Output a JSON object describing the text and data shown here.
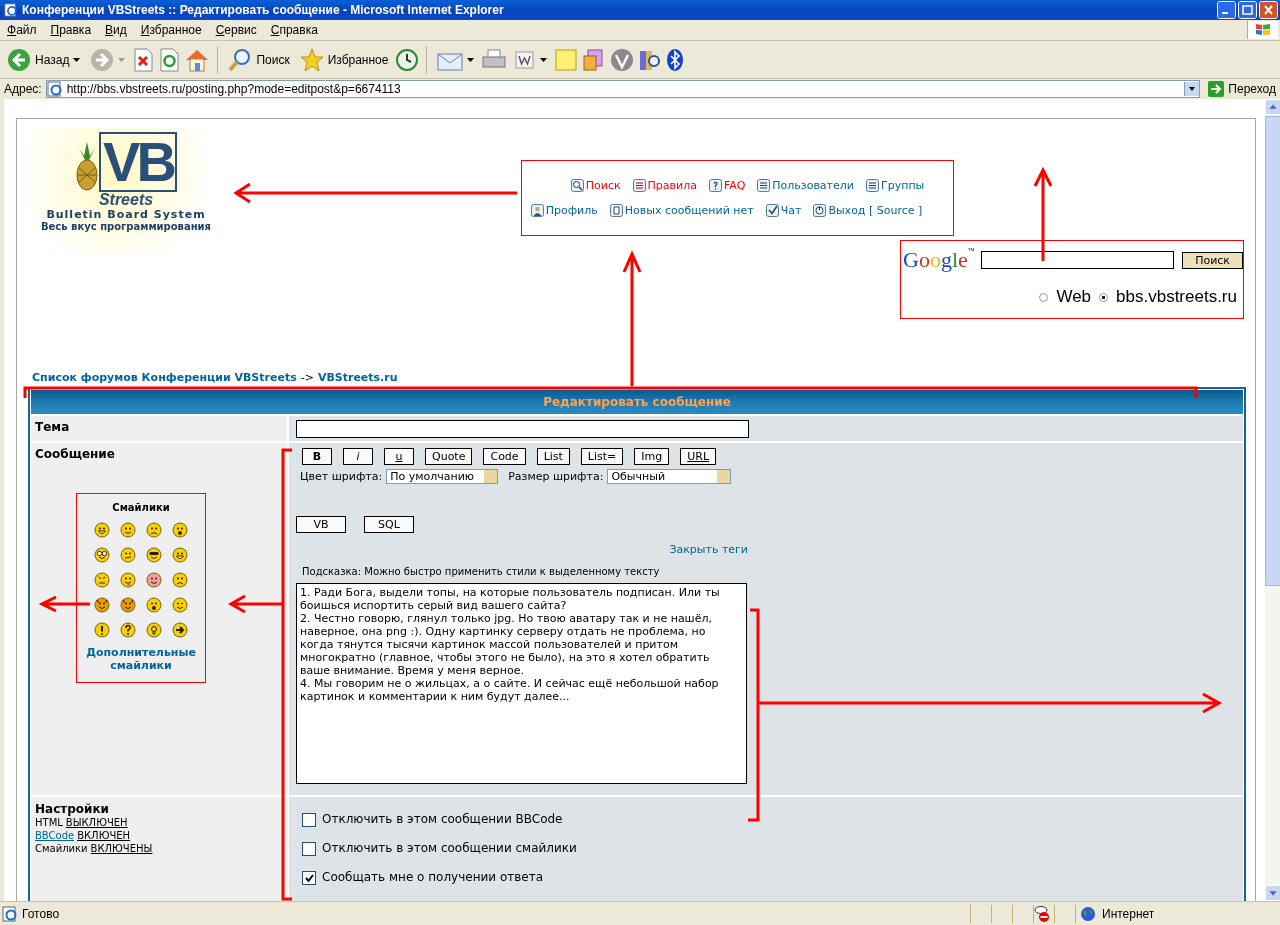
{
  "window": {
    "title": "Конференции VBStreets :: Редактировать сообщение - Microsoft Internet Explorer"
  },
  "menu": [
    "Файл",
    "Правка",
    "Вид",
    "Избранное",
    "Сервис",
    "Справка"
  ],
  "toolbar": {
    "back": "Назад",
    "search": "Поиск",
    "favorites": "Избранное"
  },
  "address_bar": {
    "label": "Адрес:",
    "url": "http://bbs.vbstreets.ru/posting.php?mode=editpost&p=6674113",
    "go": "Переход"
  },
  "logo": {
    "mark": "VB",
    "name": "Streets",
    "subtitle": "Bulletin Board System",
    "slogan": "Весь вкус программирования"
  },
  "nav": [
    {
      "label": "Поиск",
      "color": "#ff0000"
    },
    {
      "label": "Правила",
      "color": "#ff0000"
    },
    {
      "label": "FAQ",
      "color": "#ff0000"
    },
    {
      "label": "Пользователи",
      "color": "#006699"
    },
    {
      "label": "Группы",
      "color": "#006699"
    },
    {
      "label": "Профиль",
      "color": "#006699"
    },
    {
      "label": "Новых сообщений нет",
      "color": "#006699"
    },
    {
      "label": "Чат",
      "color": "#006699"
    },
    {
      "label": "Выход [ Source ]",
      "color": "#006699"
    }
  ],
  "google": {
    "logo": "Google",
    "trademark": "™",
    "button": "Поиск",
    "options": [
      {
        "label": "Web",
        "selected": false
      },
      {
        "label": "bbs.vbstreets.ru",
        "selected": true
      }
    ]
  },
  "breadcrumb": {
    "forum_list": "Список форумов Конференции VBStreets",
    "separator": "->",
    "forum": "VBStreets.ru"
  },
  "form": {
    "title": "Редактировать сообщение",
    "subject_label": "Тема",
    "message_label": "Сообщение",
    "smilies_title": "Смайлики",
    "smilies": [
      {
        "kind": "grin"
      },
      {
        "kind": "smile"
      },
      {
        "kind": "sad"
      },
      {
        "kind": "surprised"
      },
      {
        "kind": "rolleyes"
      },
      {
        "kind": "confused"
      },
      {
        "kind": "cool"
      },
      {
        "kind": "laugh"
      },
      {
        "kind": "mad"
      },
      {
        "kind": "razz"
      },
      {
        "kind": "embarrassed"
      },
      {
        "kind": "frown"
      },
      {
        "kind": "evil"
      },
      {
        "kind": "twisted"
      },
      {
        "kind": "shocked"
      },
      {
        "kind": "wink"
      },
      {
        "kind": "exclaim"
      },
      {
        "kind": "question"
      },
      {
        "kind": "idea"
      },
      {
        "kind": "arrow"
      }
    ],
    "more_smilies": "Дополнительные смайлики",
    "bbcode_buttons": [
      "B",
      "i",
      "u",
      "Quote",
      "Code",
      "List",
      "List=",
      "Img",
      "URL"
    ],
    "font_color_label": "Цвет шрифта:",
    "font_color": "По умолчанию",
    "font_size_label": "Размер шрифта:",
    "font_size": "Обычный",
    "extra_buttons": [
      "VB",
      "SQL"
    ],
    "close_tags": "Закрыть теги",
    "hint": "Подсказка: Можно быстро применить стили к выделенному тексту",
    "message": [
      "1. Ради Бога, выдели топы, на которые пользователь подписан. Или ты боишься испортить серый вид вашего сайта?",
      "2. Честно говорю, глянул только jpg. Но твою аватару так и не нашёл, наверное, она png :). Одну картинку серверу отдать не проблема, но когда тянутся тысячи картинок массой пользователей и притом многократно (главное, чтобы этого не было), на это я хотел обратить ваше внимание. Время у меня верное.",
      "4. Мы говорим не о жильцах, а о сайте. И сейчас ещё небольшой набор картинок и комментарии к ним будут далее..."
    ],
    "settings_label": "Настройки",
    "settings": [
      {
        "name": "HTML",
        "value": "ВЫКЛЮЧЕН",
        "link": false
      },
      {
        "name": "BBCode",
        "value": "ВКЛЮЧЕН",
        "link": true
      },
      {
        "name": "Смайлики",
        "value": "ВКЛЮЧЕНЫ",
        "link": false
      }
    ],
    "options": [
      {
        "label": "Отключить в этом сообщении BBCode",
        "checked": false
      },
      {
        "label": "Отключить в этом сообщении смайлики",
        "checked": false
      },
      {
        "label": "Сообщать мне о получении ответа",
        "checked": true
      }
    ]
  },
  "status_bar": {
    "text": "Готово",
    "zone": "Интернет"
  }
}
